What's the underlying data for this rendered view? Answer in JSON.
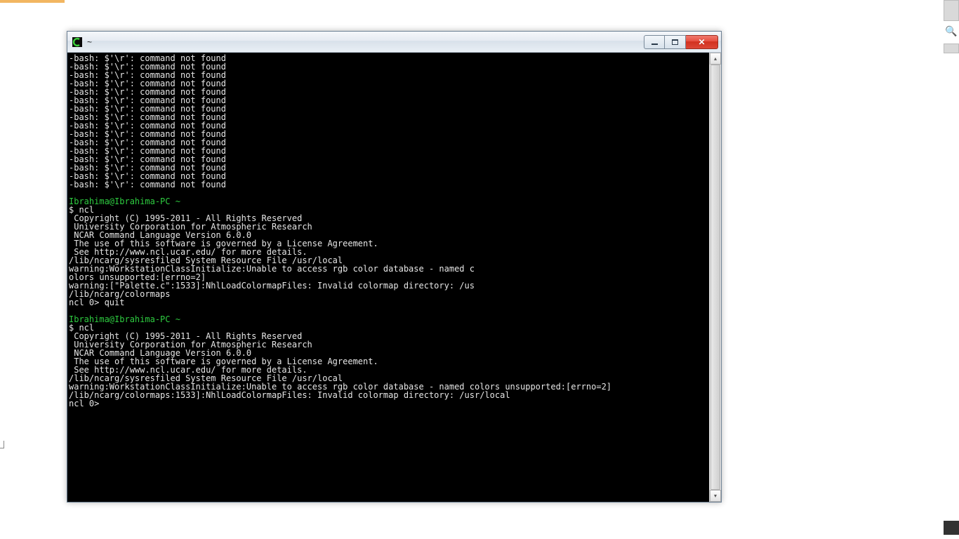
{
  "window": {
    "title": "~",
    "icon_name": "cygwin-icon"
  },
  "terminal": {
    "bash_error_line": "-bash: $'\\r': command not found",
    "bash_error_repeat": 16,
    "sessions": [
      {
        "prompt_user": "Ibrahima@Ibrahima-PC",
        "prompt_path": " ~",
        "command": "$ ncl",
        "output": [
          " Copyright (C) 1995-2011 - All Rights Reserved",
          " University Corporation for Atmospheric Research",
          " NCAR Command Language Version 6.0.0",
          " The use of this software is governed by a License Agreement.",
          " See http://www.ncl.ucar.edu/ for more details.",
          "/lib/ncarg/sysresfiled System Resource File /usr/local",
          "warning:WorkstationClassInitialize:Unable to access rgb color database - named c",
          "olors unsupported:[errno=2]",
          "warning:[\"Palette.c\":1533]:NhlLoadColormapFiles: Invalid colormap directory: /us",
          "/lib/ncarg/colormaps",
          "ncl 0> quit"
        ]
      },
      {
        "prompt_user": "Ibrahima@Ibrahima-PC",
        "prompt_path": " ~",
        "command": "$ ncl",
        "output": [
          " Copyright (C) 1995-2011 - All Rights Reserved",
          " University Corporation for Atmospheric Research",
          " NCAR Command Language Version 6.0.0",
          " The use of this software is governed by a License Agreement.",
          " See http://www.ncl.ucar.edu/ for more details.",
          "/lib/ncarg/sysresfiled System Resource File /usr/local",
          "warning:WorkstationClassInitialize:Unable to access rgb color database - named colors unsupported:[errno=2]",
          "/lib/ncarg/colormaps:1533]:NhlLoadColormapFiles: Invalid colormap directory: /usr/local",
          "ncl 0>"
        ]
      }
    ]
  },
  "controls": {
    "minimize": "minimize",
    "maximize": "maximize",
    "close": "close"
  }
}
